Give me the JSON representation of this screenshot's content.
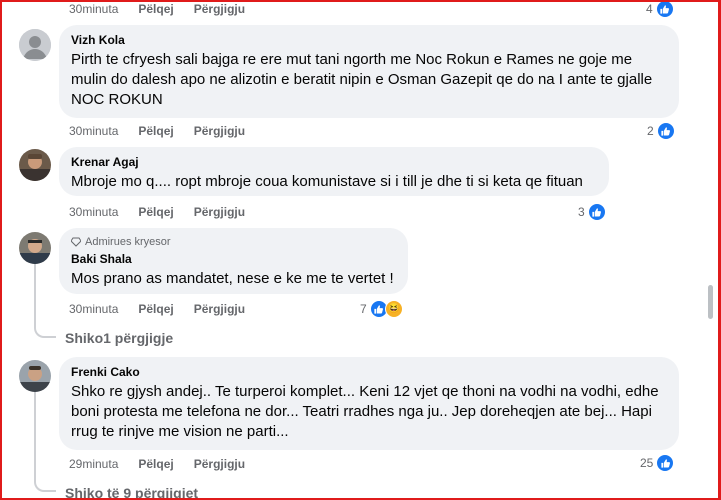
{
  "top_fragment": {
    "time": "30minuta",
    "like_label": "Pëlqej",
    "reply_label": "Përgjigju",
    "reaction_count": "4"
  },
  "comments": [
    {
      "author": "Vizh Kola",
      "text": "Pirth te cfryesh sali bajga re ere mut tani ngorth me Noc Rokun e Rames ne goje me mulin do dalesh apo ne alizotin e beratit nipin e Osman Gazepit qe do na I ante te gjalle NOC ROKUN",
      "time": "30minuta",
      "like_label": "Pëlqej",
      "reply_label": "Përgjigju",
      "reaction_count": "2",
      "avatar": "default-avatar"
    },
    {
      "author": "Krenar Agaj",
      "text": "Mbroje mo q.... ropt mbroje coua komunistave si i till je dhe ti si keta qe fituan",
      "time": "30minuta",
      "like_label": "Pëlqej",
      "reply_label": "Përgjigju",
      "reaction_count": "3",
      "avatar": "photo-avatar"
    },
    {
      "badge": "Admirues kryesor",
      "author": "Baki Shala",
      "text": "Mos prano as mandatet, nese e ke me te vertet !",
      "time": "30minuta",
      "like_label": "Pëlqej",
      "reply_label": "Përgjigju",
      "reaction_count": "7",
      "avatar": "photo-avatar"
    },
    {
      "author": "Frenki Cako",
      "text": "Shko re gjysh andej.. Te turperoi komplet... Keni 12 vjet qe thoni na vodhi na vodhi, edhe boni protesta me telefona ne dor... Teatri rradhes nga ju.. Jep doreheqjen ate bej... Hapi rrug te rinjve me vision ne parti...",
      "time": "29minuta",
      "like_label": "Pëlqej",
      "reply_label": "Përgjigju",
      "reaction_count": "25",
      "avatar": "photo-avatar"
    }
  ],
  "view_replies_1": "Shiko1 përgjigje",
  "view_replies_2": "Shiko të 9 përgjigjet",
  "colors": {
    "bubble": "#f0f2f5",
    "meta_text": "#65676b",
    "like_blue": "#1877f2",
    "frame_red": "#e01b1b"
  }
}
